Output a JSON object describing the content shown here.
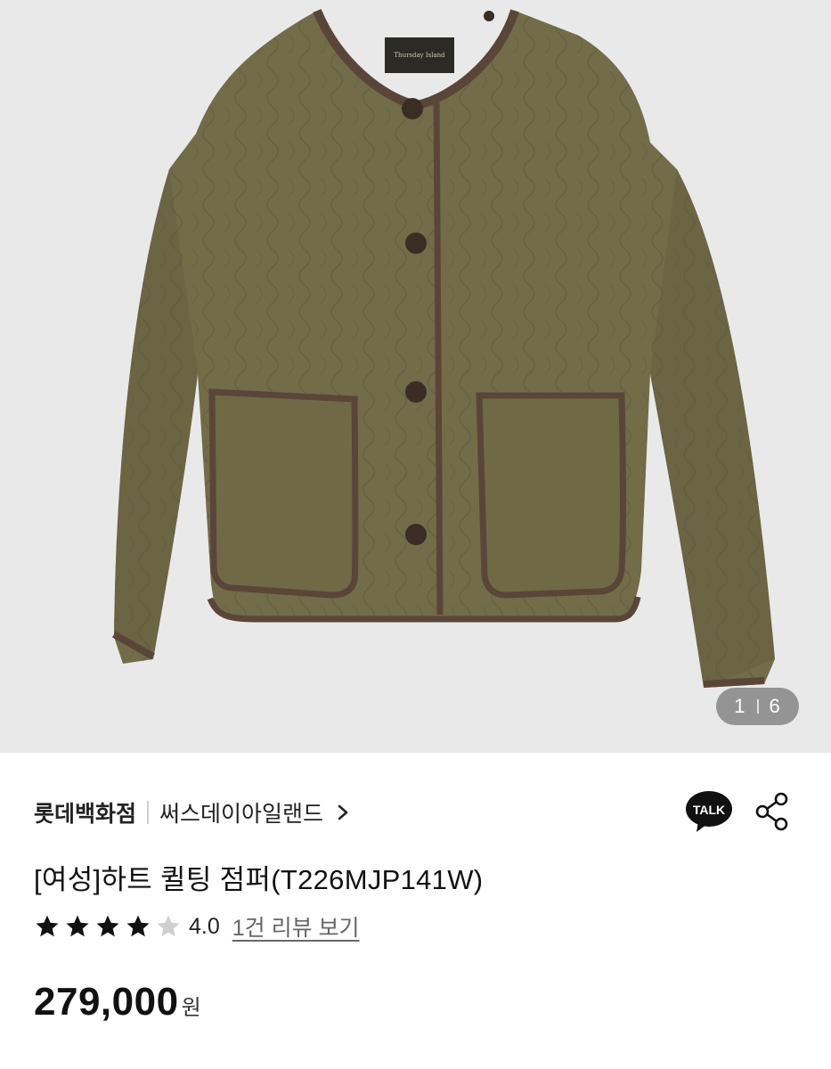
{
  "gallery": {
    "current": "1",
    "total": "6",
    "image": "olive quilted collarless jacket with brown piping and patch pockets",
    "label_text": "Thursday Island"
  },
  "seller": {
    "store": "롯데백화점",
    "brand": "써스데이아일랜드"
  },
  "actions": {
    "talk_label": "TALK"
  },
  "product": {
    "title": "[여성]하트 퀼팅 점퍼(T226MJP141W)",
    "rating": "4.0",
    "rating_stars": 4,
    "stars_total": 5,
    "review_link": "1건 리뷰 보기",
    "price": "279,000",
    "currency": "원"
  },
  "colors": {
    "gallery_bg": "#e9e9ea",
    "jacket": "#6f6a48",
    "piping": "#5a4638",
    "star_filled": "#111111",
    "star_empty": "#cfcfcf"
  }
}
